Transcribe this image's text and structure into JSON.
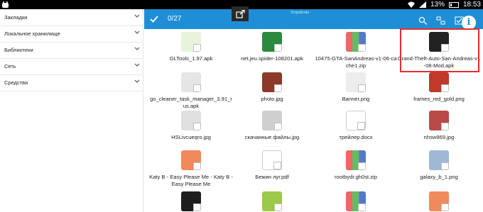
{
  "status_bar": {
    "time": "18:53",
    "battery": "13%"
  },
  "sidebar": {
    "items": [
      {
        "label": "Закладки"
      },
      {
        "label": "Локальное хранилище"
      },
      {
        "label": "Библиотеки"
      },
      {
        "label": "Сеть"
      },
      {
        "label": "Средства"
      }
    ]
  },
  "header": {
    "selection_count": "0/27",
    "breadcrumb": "Устройство"
  },
  "files": [
    {
      "name": "GLTools_1.97.apk",
      "kind": "apk"
    },
    {
      "name": "net.jeu.spider-108201.apk",
      "kind": "apk"
    },
    {
      "name": "10475-GTA-SanAndreas-v1-06-cache1.zip",
      "kind": "zip"
    },
    {
      "name": "Grand-Theft-Auto-San-Andreas-v1-08-Mod.apk",
      "kind": "apk"
    },
    {
      "name": "go_cleaner_task_manager_3.91_rus.apk",
      "kind": "apk"
    },
    {
      "name": "photo.jpg",
      "kind": "img"
    },
    {
      "name": "Banner.png",
      "kind": "img"
    },
    {
      "name": "frames_red_gold.png",
      "kind": "img"
    },
    {
      "name": "HSLivcueqro.jpg",
      "kind": "img"
    },
    {
      "name": "скачанные файлы.jpg",
      "kind": "img"
    },
    {
      "name": "трейлер.docx",
      "kind": "doc"
    },
    {
      "name": "nhsw969.jpg",
      "kind": "img"
    },
    {
      "name": "Katy B - Easy Please Me - Katy B - Easy Please Me",
      "kind": "mp3"
    },
    {
      "name": "Бежин луг.pdf",
      "kind": "pdf"
    },
    {
      "name": "rootbydr.gh0st.zip",
      "kind": "zip"
    },
    {
      "name": "galaxy_b_1.png",
      "kind": "img"
    },
    {
      "name": "",
      "kind": "apk"
    },
    {
      "name": "",
      "kind": "apk"
    },
    {
      "name": "",
      "kind": "zip"
    },
    {
      "name": "",
      "kind": "mp3"
    }
  ],
  "colors": {
    "header_blue": "#1e8fd6",
    "highlight_red": "#e52d2d"
  }
}
